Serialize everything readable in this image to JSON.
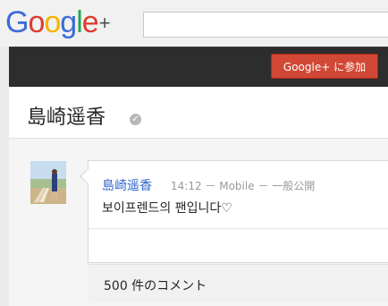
{
  "logo": {
    "parts": [
      {
        "text": "G",
        "color": "#3b6bd6"
      },
      {
        "text": "o",
        "color": "#dd3b2d"
      },
      {
        "text": "o",
        "color": "#f5b400"
      },
      {
        "text": "g",
        "color": "#3b6bd6"
      },
      {
        "text": "l",
        "color": "#2aa44f"
      },
      {
        "text": "e",
        "color": "#dd3b2d"
      }
    ],
    "plus": "+"
  },
  "header": {
    "join_button": "Google+ に参加"
  },
  "profile": {
    "name": "島崎遥香",
    "verified_icon": "check"
  },
  "post": {
    "author": "島崎遥香",
    "meta": "14:12 － Mobile － 一般公開",
    "content": "보이프렌드의 팬입니다♡"
  },
  "comments": {
    "label": "500 件のコメント"
  }
}
